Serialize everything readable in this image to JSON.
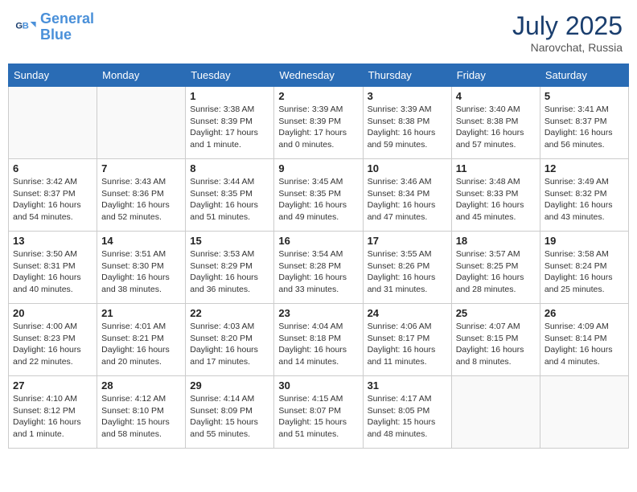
{
  "header": {
    "logo_line1": "General",
    "logo_line2": "Blue",
    "month_year": "July 2025",
    "location": "Narovchat, Russia"
  },
  "days_of_week": [
    "Sunday",
    "Monday",
    "Tuesday",
    "Wednesday",
    "Thursday",
    "Friday",
    "Saturday"
  ],
  "weeks": [
    [
      {
        "day": "",
        "info": ""
      },
      {
        "day": "",
        "info": ""
      },
      {
        "day": "1",
        "info": "Sunrise: 3:38 AM\nSunset: 8:39 PM\nDaylight: 17 hours\nand 1 minute."
      },
      {
        "day": "2",
        "info": "Sunrise: 3:39 AM\nSunset: 8:39 PM\nDaylight: 17 hours\nand 0 minutes."
      },
      {
        "day": "3",
        "info": "Sunrise: 3:39 AM\nSunset: 8:38 PM\nDaylight: 16 hours\nand 59 minutes."
      },
      {
        "day": "4",
        "info": "Sunrise: 3:40 AM\nSunset: 8:38 PM\nDaylight: 16 hours\nand 57 minutes."
      },
      {
        "day": "5",
        "info": "Sunrise: 3:41 AM\nSunset: 8:37 PM\nDaylight: 16 hours\nand 56 minutes."
      }
    ],
    [
      {
        "day": "6",
        "info": "Sunrise: 3:42 AM\nSunset: 8:37 PM\nDaylight: 16 hours\nand 54 minutes."
      },
      {
        "day": "7",
        "info": "Sunrise: 3:43 AM\nSunset: 8:36 PM\nDaylight: 16 hours\nand 52 minutes."
      },
      {
        "day": "8",
        "info": "Sunrise: 3:44 AM\nSunset: 8:35 PM\nDaylight: 16 hours\nand 51 minutes."
      },
      {
        "day": "9",
        "info": "Sunrise: 3:45 AM\nSunset: 8:35 PM\nDaylight: 16 hours\nand 49 minutes."
      },
      {
        "day": "10",
        "info": "Sunrise: 3:46 AM\nSunset: 8:34 PM\nDaylight: 16 hours\nand 47 minutes."
      },
      {
        "day": "11",
        "info": "Sunrise: 3:48 AM\nSunset: 8:33 PM\nDaylight: 16 hours\nand 45 minutes."
      },
      {
        "day": "12",
        "info": "Sunrise: 3:49 AM\nSunset: 8:32 PM\nDaylight: 16 hours\nand 43 minutes."
      }
    ],
    [
      {
        "day": "13",
        "info": "Sunrise: 3:50 AM\nSunset: 8:31 PM\nDaylight: 16 hours\nand 40 minutes."
      },
      {
        "day": "14",
        "info": "Sunrise: 3:51 AM\nSunset: 8:30 PM\nDaylight: 16 hours\nand 38 minutes."
      },
      {
        "day": "15",
        "info": "Sunrise: 3:53 AM\nSunset: 8:29 PM\nDaylight: 16 hours\nand 36 minutes."
      },
      {
        "day": "16",
        "info": "Sunrise: 3:54 AM\nSunset: 8:28 PM\nDaylight: 16 hours\nand 33 minutes."
      },
      {
        "day": "17",
        "info": "Sunrise: 3:55 AM\nSunset: 8:26 PM\nDaylight: 16 hours\nand 31 minutes."
      },
      {
        "day": "18",
        "info": "Sunrise: 3:57 AM\nSunset: 8:25 PM\nDaylight: 16 hours\nand 28 minutes."
      },
      {
        "day": "19",
        "info": "Sunrise: 3:58 AM\nSunset: 8:24 PM\nDaylight: 16 hours\nand 25 minutes."
      }
    ],
    [
      {
        "day": "20",
        "info": "Sunrise: 4:00 AM\nSunset: 8:23 PM\nDaylight: 16 hours\nand 22 minutes."
      },
      {
        "day": "21",
        "info": "Sunrise: 4:01 AM\nSunset: 8:21 PM\nDaylight: 16 hours\nand 20 minutes."
      },
      {
        "day": "22",
        "info": "Sunrise: 4:03 AM\nSunset: 8:20 PM\nDaylight: 16 hours\nand 17 minutes."
      },
      {
        "day": "23",
        "info": "Sunrise: 4:04 AM\nSunset: 8:18 PM\nDaylight: 16 hours\nand 14 minutes."
      },
      {
        "day": "24",
        "info": "Sunrise: 4:06 AM\nSunset: 8:17 PM\nDaylight: 16 hours\nand 11 minutes."
      },
      {
        "day": "25",
        "info": "Sunrise: 4:07 AM\nSunset: 8:15 PM\nDaylight: 16 hours\nand 8 minutes."
      },
      {
        "day": "26",
        "info": "Sunrise: 4:09 AM\nSunset: 8:14 PM\nDaylight: 16 hours\nand 4 minutes."
      }
    ],
    [
      {
        "day": "27",
        "info": "Sunrise: 4:10 AM\nSunset: 8:12 PM\nDaylight: 16 hours\nand 1 minute."
      },
      {
        "day": "28",
        "info": "Sunrise: 4:12 AM\nSunset: 8:10 PM\nDaylight: 15 hours\nand 58 minutes."
      },
      {
        "day": "29",
        "info": "Sunrise: 4:14 AM\nSunset: 8:09 PM\nDaylight: 15 hours\nand 55 minutes."
      },
      {
        "day": "30",
        "info": "Sunrise: 4:15 AM\nSunset: 8:07 PM\nDaylight: 15 hours\nand 51 minutes."
      },
      {
        "day": "31",
        "info": "Sunrise: 4:17 AM\nSunset: 8:05 PM\nDaylight: 15 hours\nand 48 minutes."
      },
      {
        "day": "",
        "info": ""
      },
      {
        "day": "",
        "info": ""
      }
    ]
  ]
}
